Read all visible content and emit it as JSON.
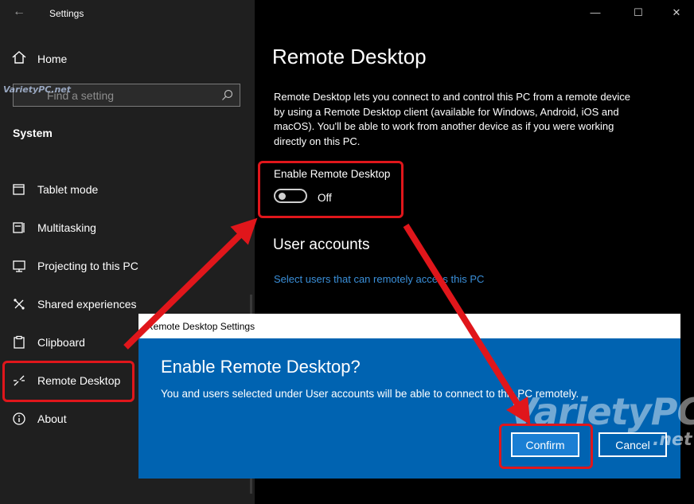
{
  "window": {
    "app_title": "Settings",
    "min_glyph": "—",
    "max_glyph": "☐",
    "close_glyph": "✕"
  },
  "sidebar": {
    "home_label": "Home",
    "search_placeholder": "Find a setting",
    "section_header": "System",
    "items": [
      {
        "label": "Tablet mode",
        "icon": "tablet-icon"
      },
      {
        "label": "Multitasking",
        "icon": "multitasking-icon"
      },
      {
        "label": "Projecting to this PC",
        "icon": "projecting-icon"
      },
      {
        "label": "Shared experiences",
        "icon": "shared-experiences-icon"
      },
      {
        "label": "Clipboard",
        "icon": "clipboard-icon"
      },
      {
        "label": "Remote Desktop",
        "icon": "remote-desktop-icon",
        "selected": true
      },
      {
        "label": "About",
        "icon": "info-icon"
      }
    ]
  },
  "main": {
    "title": "Remote Desktop",
    "description": "Remote Desktop lets you connect to and control this PC from a remote device by using a Remote Desktop client (available for Windows, Android, iOS and macOS). You'll be able to work from another device as if you were working directly on this PC.",
    "enable_label": "Enable Remote Desktop",
    "toggle_state": "Off",
    "user_accounts_heading": "User accounts",
    "select_users_link": "Select users that can remotely access this PC"
  },
  "dialog": {
    "window_title": "Remote Desktop Settings",
    "heading": "Enable Remote Desktop?",
    "message": "You and users selected under User accounts will be able to connect to this PC remotely.",
    "confirm_label": "Confirm",
    "cancel_label": "Cancel"
  },
  "watermark": {
    "brand": "VarietyPC",
    "suffix": ".net",
    "small": "VarietyPC.net"
  },
  "colors": {
    "sidebar_bg": "#1f1f1f",
    "dialog_bg": "#0063b1",
    "link": "#3a8fd9",
    "annotation_red": "#e0161b"
  }
}
